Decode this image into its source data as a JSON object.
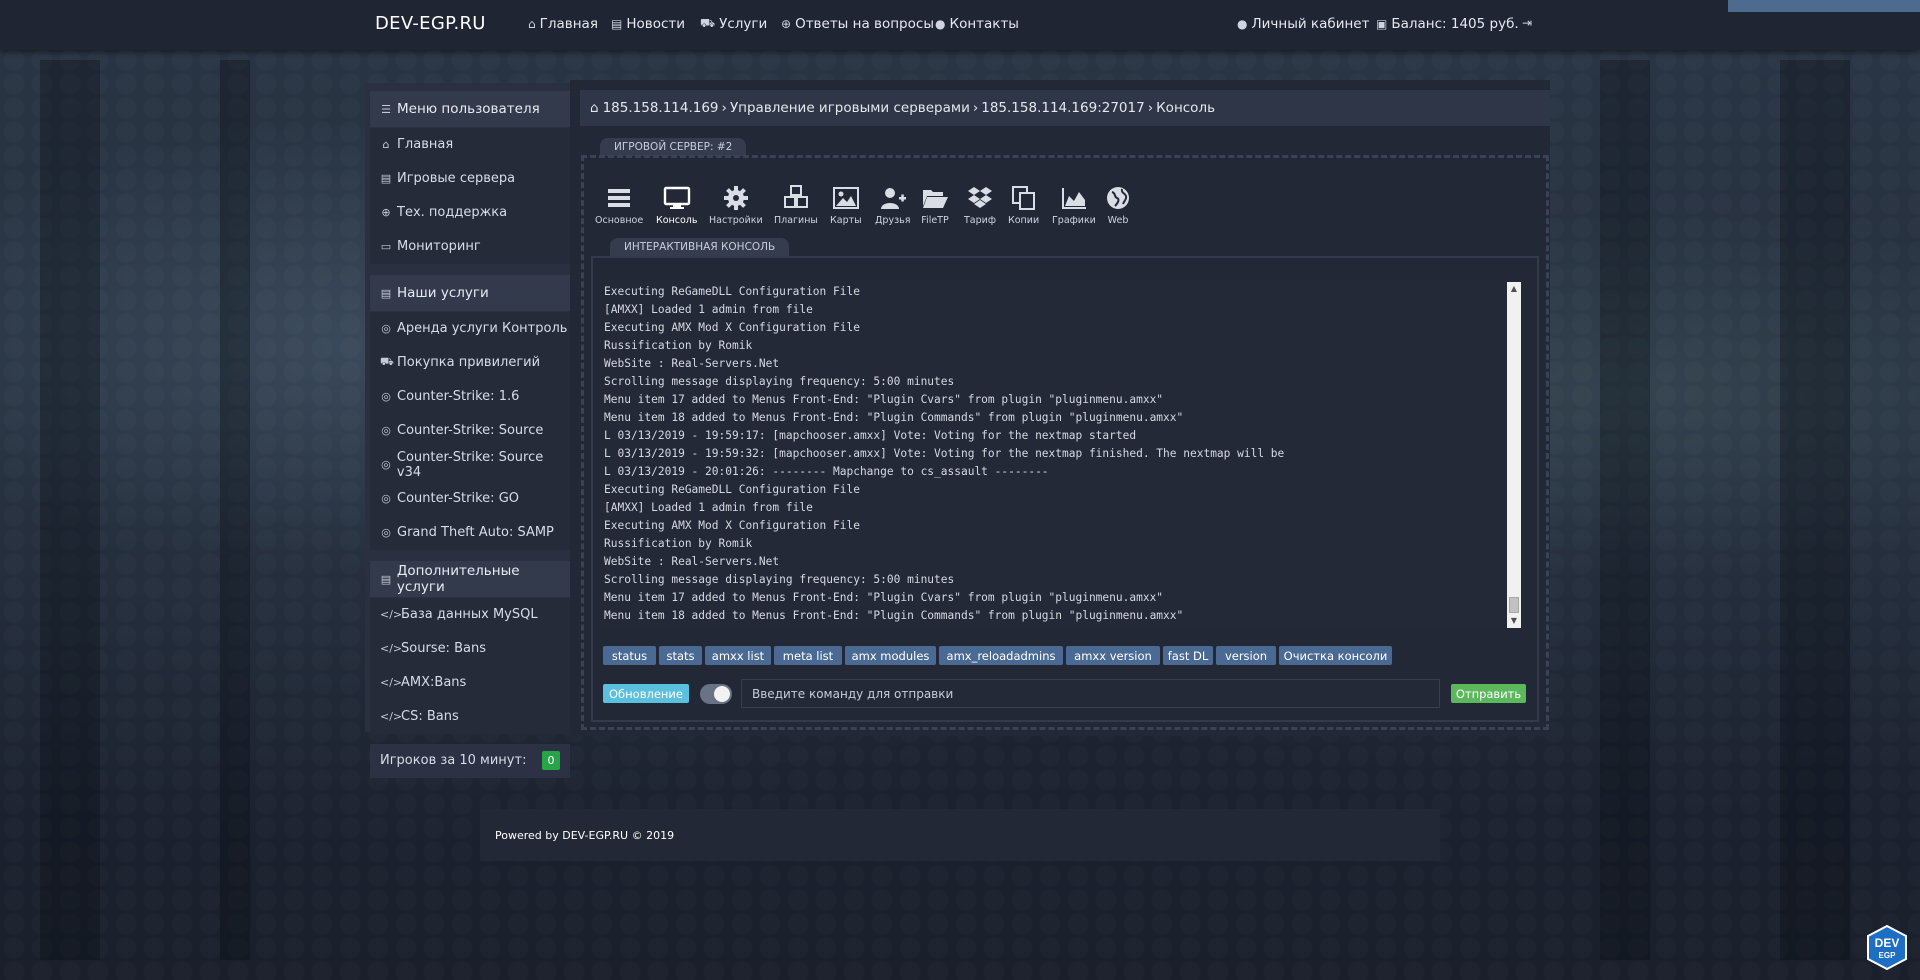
{
  "header": {
    "brand": "DEV-EGP.RU",
    "nav": [
      {
        "icon": "home-icon",
        "label": "Главная"
      },
      {
        "icon": "newspaper-icon",
        "label": "Новости"
      },
      {
        "icon": "cart-icon",
        "label": "Услуги"
      },
      {
        "icon": "lifebuoy-icon",
        "label": "Ответы на вопросы"
      },
      {
        "icon": "user-icon",
        "label": "Контакты"
      }
    ],
    "account_label": "Личный кабинет",
    "balance_label": "Баланс: 1405 руб."
  },
  "sidebar": {
    "user_menu_title": "Меню пользователя",
    "user_menu": [
      "Главная",
      "Игровые сервера",
      "Тех. поддержка",
      "Мониторинг"
    ],
    "services_title": "Наши услуги",
    "services": [
      "Аренда услуги Контроль",
      "Покупка привилегий",
      "Counter-Strike: 1.6",
      "Counter-Strike: Source",
      "Counter-Strike: Source v34",
      "Counter-Strike: GO",
      "Grand Theft Auto: SAMP"
    ],
    "extra_title": "Дополнительные услуги",
    "extra": [
      "База данных MySQL",
      "Sourse: Bans",
      "AMX:Bans",
      "CS: Bans"
    ],
    "players_label": "Игроков за 10 минут:",
    "players_count": "0"
  },
  "breadcrumb": {
    "items": [
      "185.158.114.169",
      "Управление игровыми серверами",
      "185.158.114.169:27017",
      "Консоль"
    ]
  },
  "server_tab": "ИГРОВОЙ СЕРВЕР: #2",
  "toolbar": [
    {
      "icon": "menu-icon",
      "label": "Основное"
    },
    {
      "icon": "monitor-icon",
      "label": "Консоль"
    },
    {
      "icon": "gear-icon",
      "label": "Настройки"
    },
    {
      "icon": "cubes-icon",
      "label": "Плагины"
    },
    {
      "icon": "image-icon",
      "label": "Карты"
    },
    {
      "icon": "user-plus-icon",
      "label": "Друзья"
    },
    {
      "icon": "folder-open-icon",
      "label": "FileTP"
    },
    {
      "icon": "dropbox-icon",
      "label": "Тариф"
    },
    {
      "icon": "copy-icon",
      "label": "Копии"
    },
    {
      "icon": "area-chart-icon",
      "label": "Графики"
    },
    {
      "icon": "globe-icon",
      "label": "Web"
    }
  ],
  "console_tab": "ИНТЕРАКТИВНАЯ КОНСОЛЬ",
  "console_lines": [
    "Executing ReGameDLL Configuration File",
    "[AMXX] Loaded 1 admin from file",
    "Executing AMX Mod X Configuration File",
    "Russification by Romik",
    "WebSite : Real-Servers.Net",
    "Scrolling message displaying frequency: 5:00 minutes",
    "Menu item 17 added to Menus Front-End: \"Plugin Cvars\" from plugin \"pluginmenu.amxx\"",
    "Menu item 18 added to Menus Front-End: \"Plugin Commands\" from plugin \"pluginmenu.amxx\"",
    "L 03/13/2019 - 19:59:17: [mapchooser.amxx] Vote: Voting for the nextmap started",
    "L 03/13/2019 - 19:59:32: [mapchooser.amxx] Vote: Voting for the nextmap finished. The nextmap will be",
    "L 03/13/2019 - 20:01:26: -------- Mapchange to cs_assault --------",
    "Executing ReGameDLL Configuration File",
    "[AMXX] Loaded 1 admin from file",
    "Executing AMX Mod X Configuration File",
    "Russification by Romik",
    "WebSite : Real-Servers.Net",
    "Scrolling message displaying frequency: 5:00 minutes",
    "Menu item 17 added to Menus Front-End: \"Plugin Cvars\" from plugin \"pluginmenu.amxx\"",
    "Menu item 18 added to Menus Front-End: \"Plugin Commands\" from plugin \"pluginmenu.amxx\""
  ],
  "commands": [
    "status",
    "stats",
    "amxx list",
    "meta list",
    "amx modules",
    "amx_reloadadmins",
    "amxx version",
    "fast DL",
    "version",
    "Очистка консоли"
  ],
  "refresh_label": "Обновление",
  "input_placeholder": "Введите команду для отправки",
  "send_label": "Отправить",
  "footer": "Powered by DEV-EGP.RU © 2019",
  "logo": {
    "line1": "DEV",
    "line2": "EGP"
  },
  "colors": {
    "accent": "#4a6a93",
    "send": "#5cb85c",
    "refresh": "#5bc0de",
    "badge": "#27a348"
  }
}
